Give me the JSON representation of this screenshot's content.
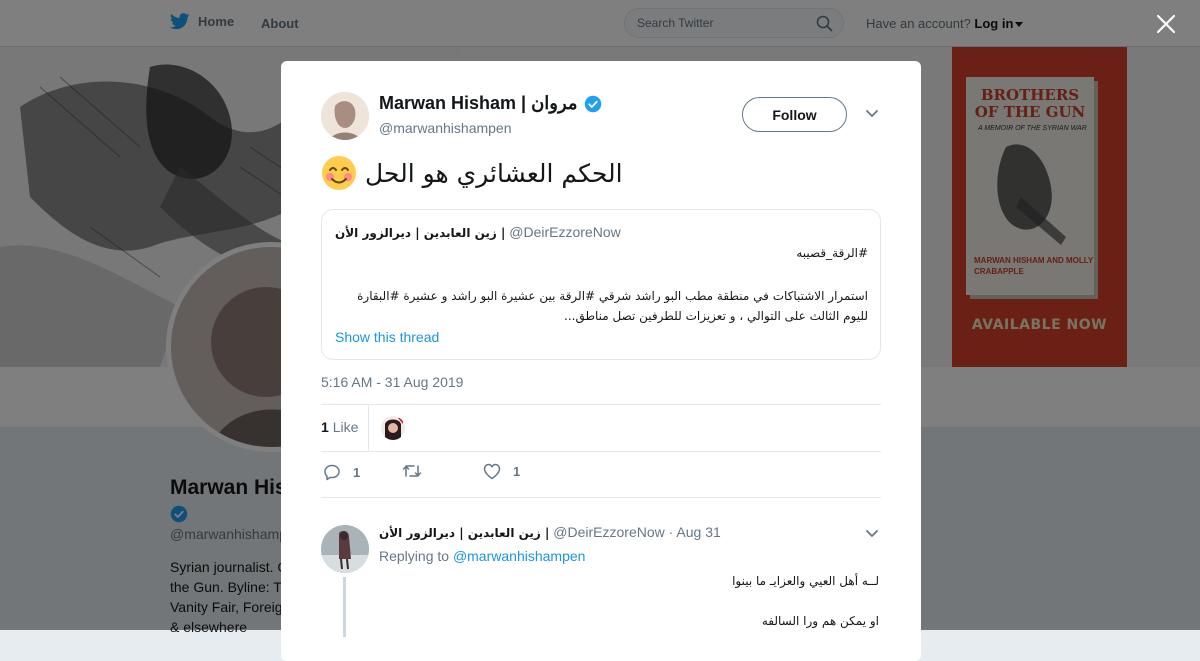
{
  "nav": {
    "home_label": "Home",
    "about_label": "About",
    "search_placeholder": "Search Twitter",
    "account_prompt": "Have an account?",
    "login_label": "Log in"
  },
  "background_profile": {
    "name": "Marwan His",
    "handle": "@marwanhishamp",
    "bio_lines": [
      "Syrian journalist. C",
      "the Gun. Byline: T",
      "Vanity Fair, Foreig",
      "& elsewhere"
    ],
    "banner_book": {
      "title": "BROTHERS OF THE GUN",
      "subtitle": "A MEMOIR OF THE SYRIAN WAR",
      "authors": "MARWAN HISHAM AND MOLLY CRABAPPLE",
      "cta": "AVAILABLE NOW"
    }
  },
  "tweet": {
    "author_name": "Marwan Hisham | مروان",
    "author_handle": "@marwanhishampen",
    "follow_label": "Follow",
    "text": "الحكم العشائري هو الحل",
    "emoji": "😊",
    "quoted": {
      "author_name": "زين العابدين | ديرالزور الأن |",
      "author_handle": "@DeirEzzoreNow",
      "hashtag_line": "#الرقة_قصيبه",
      "body": "استمرار الاشتباكات في منطقة مطب البو راشد شرقي #الرقة بين عشيرة البو راشد و عشيرة #البقارة لليوم الثالث على التوالي ، و تعزيزات للطرفين تصل مناطق...",
      "show_thread_label": "Show this thread"
    },
    "timestamp": "5:16 AM - 31 Aug 2019",
    "likes_count": "1",
    "likes_label": "Like",
    "actions": {
      "reply_count": "1",
      "retweet_count": "",
      "like_count": "1"
    }
  },
  "reply": {
    "author_name": "زين العابدين | ديرالزور الأن |",
    "author_handle": "@DeirEzzoreNow",
    "date": "· Aug 31",
    "replying_prefix": "Replying to",
    "replying_to": "@marwanhishampen",
    "line1": "لــه أهل العيي والعزايـ ما بينوا",
    "line2": "او يمكن هم ورا السالفه"
  },
  "colors": {
    "brand_blue": "#1da1f2",
    "link_blue": "#1b95e0",
    "overlay": "rgba(0,0,0,0.5)",
    "banner_book_red": "#d6412a"
  },
  "icons": [
    "twitter-bird-icon",
    "search-icon",
    "close-icon",
    "verified-badge-icon",
    "chevron-down-icon",
    "reply-icon",
    "retweet-icon",
    "heart-icon",
    "smiling-face-emoji"
  ]
}
